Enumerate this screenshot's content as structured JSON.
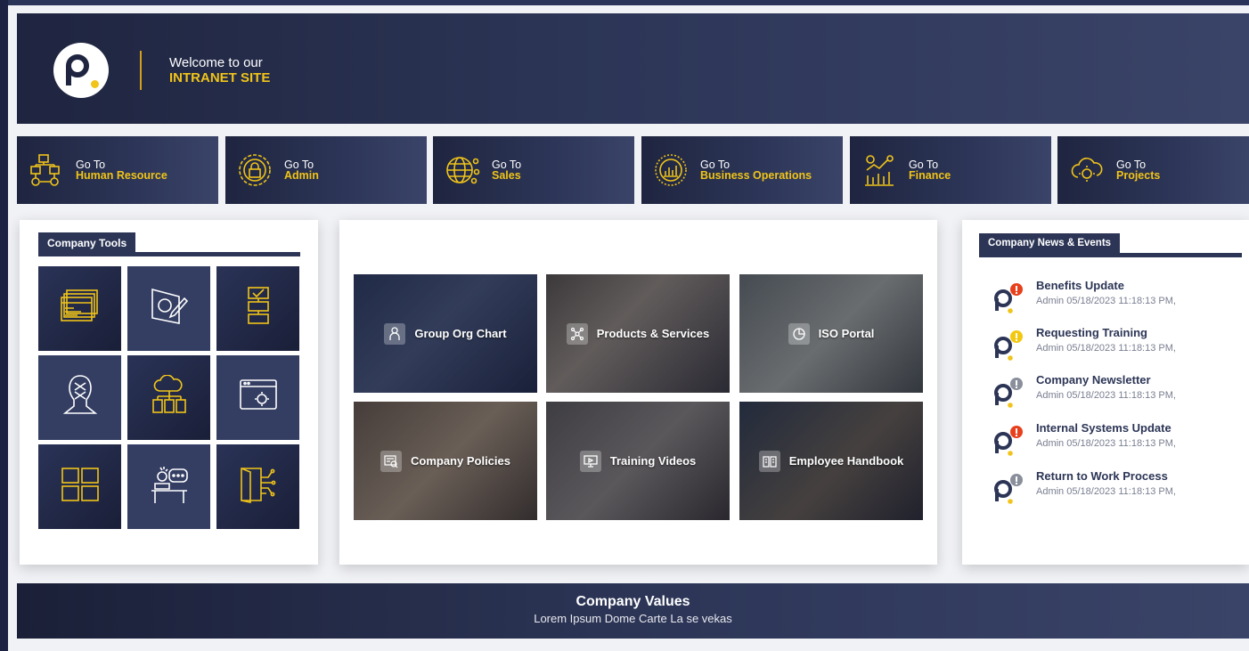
{
  "header": {
    "welcome_line1": "Welcome to our",
    "welcome_line2": "INTRANET SITE",
    "logo_icon": "padel-racket-logo"
  },
  "departments": [
    {
      "goto": "Go To",
      "name": "Human Resource",
      "icon": "flowchart-icon"
    },
    {
      "goto": "Go To",
      "name": "Admin",
      "icon": "lock-gear-icon"
    },
    {
      "goto": "Go To",
      "name": "Sales",
      "icon": "globe-network-icon"
    },
    {
      "goto": "Go To",
      "name": "Business Operations",
      "icon": "chart-badge-icon"
    },
    {
      "goto": "Go To",
      "name": "Finance",
      "icon": "finance-bars-icon"
    },
    {
      "goto": "Go To",
      "name": "Projects",
      "icon": "cloud-projects-icon"
    }
  ],
  "company_tools": {
    "title": "Company Tools",
    "tools": [
      {
        "icon": "code-windows-icon"
      },
      {
        "icon": "design-tool-icon"
      },
      {
        "icon": "checklist-flow-icon"
      },
      {
        "icon": "tech-head-icon"
      },
      {
        "icon": "cloud-hierarchy-icon"
      },
      {
        "icon": "browser-settings-icon"
      },
      {
        "icon": "windows-logo-icon"
      },
      {
        "icon": "support-chat-icon"
      },
      {
        "icon": "circuit-door-icon"
      }
    ]
  },
  "resources": [
    {
      "label": "Group Org Chart",
      "icon": "org-person-icon"
    },
    {
      "label": "Products & Services",
      "icon": "network-nodes-icon"
    },
    {
      "label": "ISO Portal",
      "icon": "pie-chart-icon"
    },
    {
      "label": "Company Policies",
      "icon": "document-search-icon"
    },
    {
      "label": "Training Videos",
      "icon": "monitor-icon"
    },
    {
      "label": "Employee Handbook",
      "icon": "open-book-icon"
    }
  ],
  "news": {
    "title": "Company News & Events",
    "items": [
      {
        "title": "Benefits Update",
        "meta": "Admin 05/18/2023 11:18:13 PM,",
        "badge_color": "#e8401c"
      },
      {
        "title": "Requesting Training",
        "meta": "Admin 05/18/2023 11:18:13 PM,",
        "badge_color": "#f2c811"
      },
      {
        "title": "Company Newsletter",
        "meta": "Admin 05/18/2023 11:18:13 PM,",
        "badge_color": "#8a8f9c"
      },
      {
        "title": "Internal Systems Update",
        "meta": "Admin 05/18/2023 11:18:13 PM,",
        "badge_color": "#e8401c"
      },
      {
        "title": "Return to Work Process",
        "meta": "Admin 05/18/2023 11:18:13 PM,",
        "badge_color": "#8a8f9c"
      }
    ]
  },
  "footer": {
    "title": "Company Values",
    "subtitle": "Lorem Ipsum Dome Carte La se vekas"
  },
  "colors": {
    "navy": "#2c3556",
    "gold": "#f0c419",
    "alert_red": "#e8401c",
    "alert_yellow": "#f2c811",
    "alert_gray": "#8a8f9c"
  }
}
